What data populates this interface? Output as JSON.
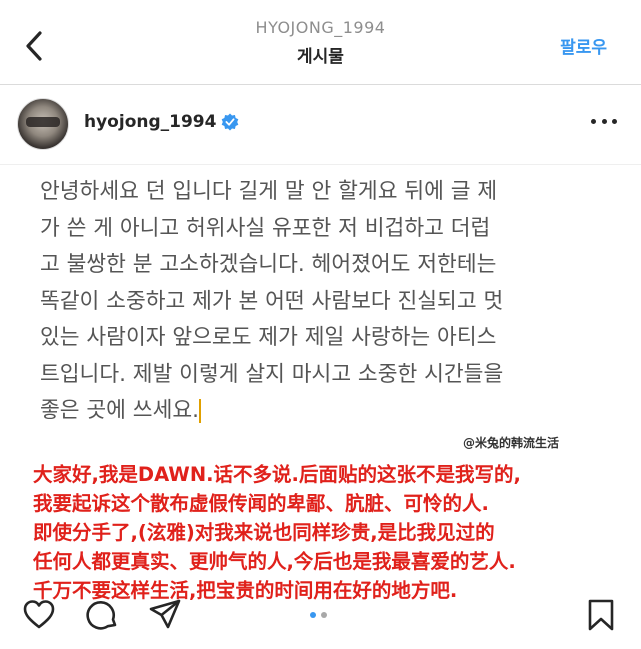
{
  "header": {
    "account_name": "HYOJONG_1994",
    "title": "게시물",
    "follow_label": "팔로우"
  },
  "profile": {
    "username": "hyojong_1994"
  },
  "post": {
    "lines": [
      "안녕하세요 던 입니다 길게 말 안 할게요 뒤에 글 제",
      "가 쓴 게 아니고 허위사실 유포한 저 비겁하고 더럽",
      "고 불쌍한 분 고소하겠습니다. 헤어졌어도 저한테는",
      "똑같이 소중하고 제가 본 어떤 사람보다 진실되고 멋",
      "있는 사람이자 앞으로도 제가 제일 사랑하는 아티스",
      "트입니다. 제발 이렇게 살지 마시고 소중한 시간들을",
      "좋은 곳에 쓰세요."
    ]
  },
  "watermark": "@米兔的韩流生活",
  "translation": {
    "lines": [
      "大家好,我是DAWN.话不多说.后面贴的这张不是我写的,",
      "我要起诉这个散布虚假传闻的卑鄙、肮脏、可怜的人.",
      "即使分手了,(泫雅)对我来说也同样珍贵,是比我见过的",
      "任何人都更真实、更帅气的人,今后也是我最喜爱的艺人.",
      "千万不要这样生活,把宝贵的时间用在好的地方吧."
    ]
  },
  "icons": {
    "back": "chevron-left-icon",
    "verified": "verified-badge-icon",
    "more": "more-options-icon",
    "like": "heart-icon",
    "comment": "comment-icon",
    "share": "send-icon",
    "save": "bookmark-icon"
  },
  "colors": {
    "accent": "#3897f0",
    "overlay_text": "#e0211b",
    "text": "#262626"
  }
}
